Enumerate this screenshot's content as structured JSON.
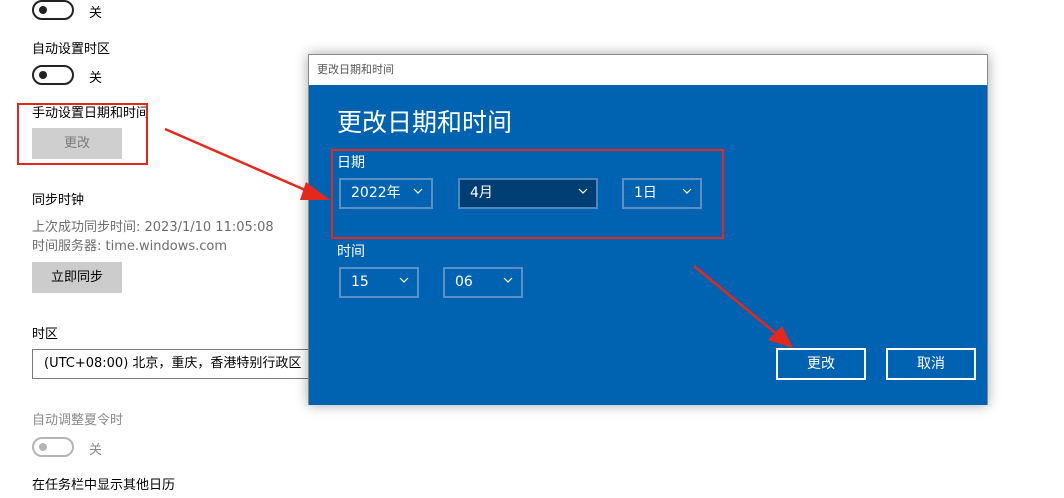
{
  "settings": {
    "top_toggle_state": "关",
    "auto_timezone": {
      "label": "自动设置时区",
      "state": "关"
    },
    "manual_datetime": {
      "label": "手动设置日期和时间",
      "button": "更改"
    },
    "sync": {
      "title": "同步时钟",
      "last_sync": "上次成功同步时间: 2023/1/10 11:05:08",
      "server": "时间服务器: time.windows.com",
      "button": "立即同步"
    },
    "timezone": {
      "title": "时区",
      "value": "(UTC+08:00) 北京，重庆，香港特别行政区"
    },
    "dst": {
      "label": "自动调整夏令时",
      "state": "关"
    },
    "other_calendars": {
      "label": "在任务栏中显示其他日历"
    }
  },
  "dialog": {
    "window_title": "更改日期和时间",
    "heading": "更改日期和时间",
    "date_label": "日期",
    "year": "2022年",
    "month": "4月",
    "day": "1日",
    "time_label": "时间",
    "hour": "15",
    "minute": "06",
    "confirm": "更改",
    "cancel": "取消"
  },
  "colors": {
    "dialog_blue": "#0063b1",
    "annotation_red": "#e5281c"
  }
}
